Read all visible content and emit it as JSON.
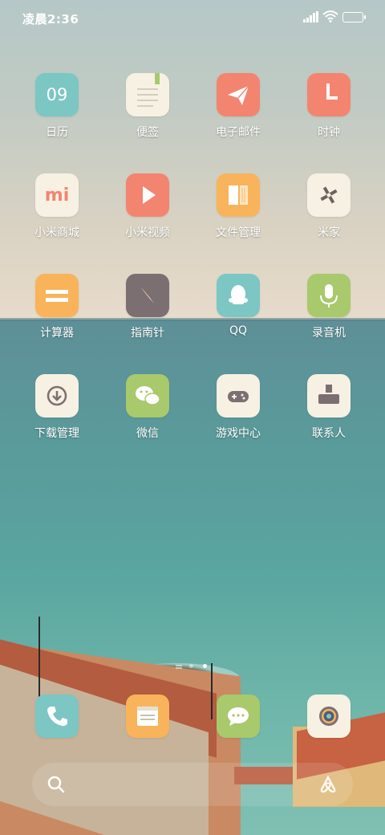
{
  "status_bar": {
    "time": "凌晨2:36"
  },
  "apps": [
    {
      "label": "日历",
      "icon": "calendar-icon",
      "color": "#7cc6c4",
      "date": "09"
    },
    {
      "label": "便签",
      "icon": "notes-icon",
      "color": "#f6f1e2"
    },
    {
      "label": "电子邮件",
      "icon": "mail-icon",
      "color": "#f38470"
    },
    {
      "label": "时钟",
      "icon": "clock-icon",
      "color": "#f38470"
    },
    {
      "label": "小米商城",
      "icon": "mi-store-icon",
      "color": "#f6f1e2",
      "glyph": "mi"
    },
    {
      "label": "小米视频",
      "icon": "video-icon",
      "color": "#f38470"
    },
    {
      "label": "文件管理",
      "icon": "file-manager-icon",
      "color": "#f9b35b"
    },
    {
      "label": "米家",
      "icon": "mijia-icon",
      "color": "#f6f1e2"
    },
    {
      "label": "计算器",
      "icon": "calculator-icon",
      "color": "#f9b35b"
    },
    {
      "label": "指南针",
      "icon": "compass-icon",
      "color": "#7b6f72"
    },
    {
      "label": "QQ",
      "icon": "qq-icon",
      "color": "#7cc6c4"
    },
    {
      "label": "录音机",
      "icon": "recorder-icon",
      "color": "#a8c96c"
    },
    {
      "label": "下载管理",
      "icon": "download-icon",
      "color": "#f6f1e2"
    },
    {
      "label": "微信",
      "icon": "wechat-icon",
      "color": "#a8c96c"
    },
    {
      "label": "游戏中心",
      "icon": "game-center-icon",
      "color": "#f6f1e2"
    },
    {
      "label": "联系人",
      "icon": "contacts-icon",
      "color": "#f6f1e2"
    }
  ],
  "dock": [
    {
      "icon": "phone-icon",
      "color": "#7cc6c4"
    },
    {
      "icon": "browser-icon",
      "color": "#f9b35b"
    },
    {
      "icon": "messages-icon",
      "color": "#a8c96c"
    },
    {
      "icon": "camera-icon",
      "color": "#f6f1e2"
    }
  ],
  "page_indicator": {
    "pages": 3,
    "current": 3
  }
}
